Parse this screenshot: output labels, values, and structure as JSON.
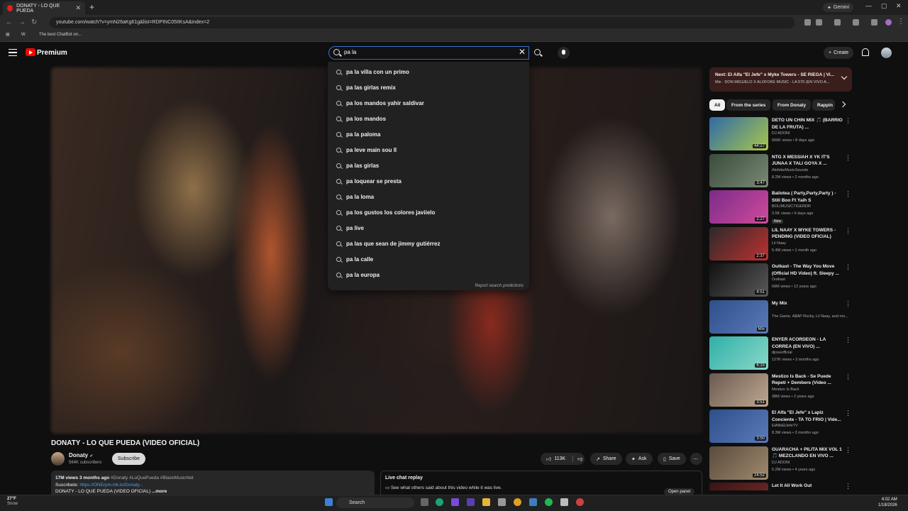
{
  "browser": {
    "tab_title": "DONATY - LO QUE PUEDA",
    "url": "youtube.com/watch?v=ymN26aKg61g&list=RDPINC05IIKsA&index=2",
    "gemini_label": "Gemini",
    "bookmarks": [
      "W",
      "The best ChatBot on..."
    ]
  },
  "header": {
    "brand": "Premium",
    "search_value": "pa la",
    "create_label": "Create"
  },
  "suggestions": [
    "pa la villa con un primo",
    "pa las girlas remix",
    "pa los mandos yahir saldivar",
    "pa los mandos",
    "pa la paloma",
    "pa leve main sou ll",
    "pa las girlas",
    "pa loquear se presta",
    "pa la loma",
    "pa los gustos los colores javiielo",
    "pa live",
    "pa las que sean de jimmy gutiérrez",
    "pa la calle",
    "pa la europa"
  ],
  "report_label": "Report search predictions",
  "video": {
    "title": "DONATY - LO QUE PUEDA (VIDEO OFICIAL)",
    "channel": "Donaty",
    "subscribers": "564K subscribers",
    "subscribe_label": "Subscribe",
    "likes": "113K",
    "share_label": "Share",
    "ask_label": "Ask",
    "save_label": "Save",
    "stats": "17M views  3 months ago",
    "hashtags": "#Donaty #LoQuePueda #BlazeMusicNet",
    "subscribe_line": "Suscribete:",
    "subscribe_link": "https://ONErpm.lnk.to/Donaty...",
    "desc_line": "DONATY - LO QUE PUEDA (VIDEO OFICIAL)",
    "more_label": "...more",
    "chat_title": "Live chat replay",
    "chat_text": "See what others said about this video while it was live.",
    "open_panel_label": "Open panel"
  },
  "next_up": {
    "line1": "Next: El Alfa \"El Jefe\" x Myke Towers - SE RIEGA | Vi...",
    "line2": "Mix · DON MIGUELO X ALOFOKE MUSIC - LA 570 (EN VIVO A..."
  },
  "chips": [
    "All",
    "From the series",
    "From Donaty",
    "Rappin"
  ],
  "recommendations": [
    {
      "title": "DETO UN CHIN MIX 🎵 (BARRIO DE LA FRUTA) ...",
      "channel": "DJ ADONI",
      "views": "666K views • 8 days ago",
      "duration": "44:27",
      "badge": "",
      "colors": [
        "#2f6aa8",
        "#a8c64a"
      ]
    },
    {
      "title": "NTG X MESSIAH X YK IT'S JUNAA X TALI GOYA X ...",
      "channel": "AlofokeMusicSounds",
      "views": "8.2M views • 2 months ago",
      "duration": "3:47",
      "badge": "",
      "colors": [
        "#3a4a3c",
        "#7a8a76"
      ]
    },
    {
      "title": "Bailotea ( Party,Party,Party ) - Still Boo Ft Yaih S",
      "channel": "BOLIMUSICTIGERDR",
      "views": "3.5K views • 6 days ago",
      "duration": "2:27",
      "badge": "New",
      "colors": [
        "#7a2c8a",
        "#d04a9a"
      ]
    },
    {
      "title": "LIL NAAY X MYKE TOWERS - PENDING (VIDEO OFICIAL)",
      "channel": "Lil Naay",
      "views": "5.4M views • 1 month ago",
      "duration": "2:37",
      "badge": "",
      "colors": [
        "#2a2a2a",
        "#c03030"
      ]
    },
    {
      "title": "Outkast - The Way You Move (Official HD Video) ft. Sleepy ...",
      "channel": "Outkast",
      "views": "69M views • 12 years ago",
      "duration": "4:51",
      "badge": "",
      "colors": [
        "#111111",
        "#5a5a5a"
      ]
    },
    {
      "title": "My Mix",
      "channel": "The Game, A$AP Rocky, Lil Naay, and mo...",
      "views": "",
      "duration": "Mix",
      "badge": "",
      "colors": [
        "#2d4f8a",
        "#5a7ab8"
      ]
    },
    {
      "title": "ENYER ACORDEON - LA CORREA (EN VIVO) ...",
      "channel": "djoseofficial",
      "views": "127K views • 3 months ago",
      "duration": "6:15",
      "badge": "",
      "colors": [
        "#2fb0a8",
        "#8ad8c8"
      ]
    },
    {
      "title": "Mestizo Is Back - Se Puede Repetí + Dembere (Video ...",
      "channel": "Mestizo Is Back",
      "views": "38M views • 2 years ago",
      "duration": "3:51",
      "badge": "",
      "colors": [
        "#6a5a50",
        "#c0a890"
      ]
    },
    {
      "title": "El Alfa \"El Jefe\" x Lapiz Conciente - TA TO FRIO | Vide...",
      "channel": "ElAlfaElJefeTV",
      "views": "8.3M views • 3 months ago",
      "duration": "3:50",
      "badge": "",
      "colors": [
        "#2d4f8a",
        "#5a7ab8"
      ]
    },
    {
      "title": "GUARACHA + PILITA MIX VOL 1 🎵 MEZCLANDO EN VIVO ...",
      "channel": "DJ ADONI",
      "views": "5.2M views • 4 years ago",
      "duration": "24:52",
      "badge": "",
      "colors": [
        "#5a4a3a",
        "#a08a70"
      ]
    },
    {
      "title": "Let It All Work Out",
      "channel": "",
      "views": "",
      "duration": "",
      "badge": "",
      "colors": [
        "#3a1414",
        "#7a2a2a"
      ]
    }
  ],
  "taskbar": {
    "temp": "27°F",
    "weather": "Snow",
    "search_label": "Search",
    "time": "4:02 AM",
    "date": "1/18/2026"
  }
}
